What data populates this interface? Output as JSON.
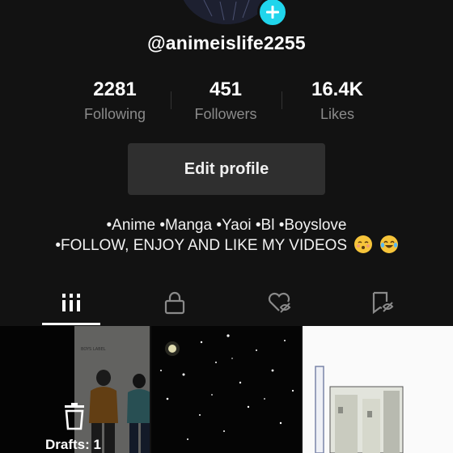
{
  "profile": {
    "username": "@animeislife2255",
    "add_icon": "plus-icon"
  },
  "stats": [
    {
      "value": "2281",
      "label": "Following"
    },
    {
      "value": "451",
      "label": "Followers"
    },
    {
      "value": "16.4K",
      "label": "Likes"
    }
  ],
  "edit_profile_label": "Edit profile",
  "bio": {
    "line1": "•Anime •Manga •Yaoi •Bl •Boyslove",
    "line2": "•FOLLOW, ENJOY AND LIKE MY VIDEOS"
  },
  "tabs": [
    {
      "icon": "grid-icon",
      "active": true
    },
    {
      "icon": "lock-icon",
      "active": false
    },
    {
      "icon": "heart-hidden-icon",
      "active": false
    },
    {
      "icon": "bookmark-hidden-icon",
      "active": false
    }
  ],
  "drafts_label": "Drafts: 1",
  "colors": {
    "background": "#121212",
    "accent": "#20d5ec",
    "muted_text": "#8a8a8a",
    "button_bg": "#2f2f2f"
  }
}
